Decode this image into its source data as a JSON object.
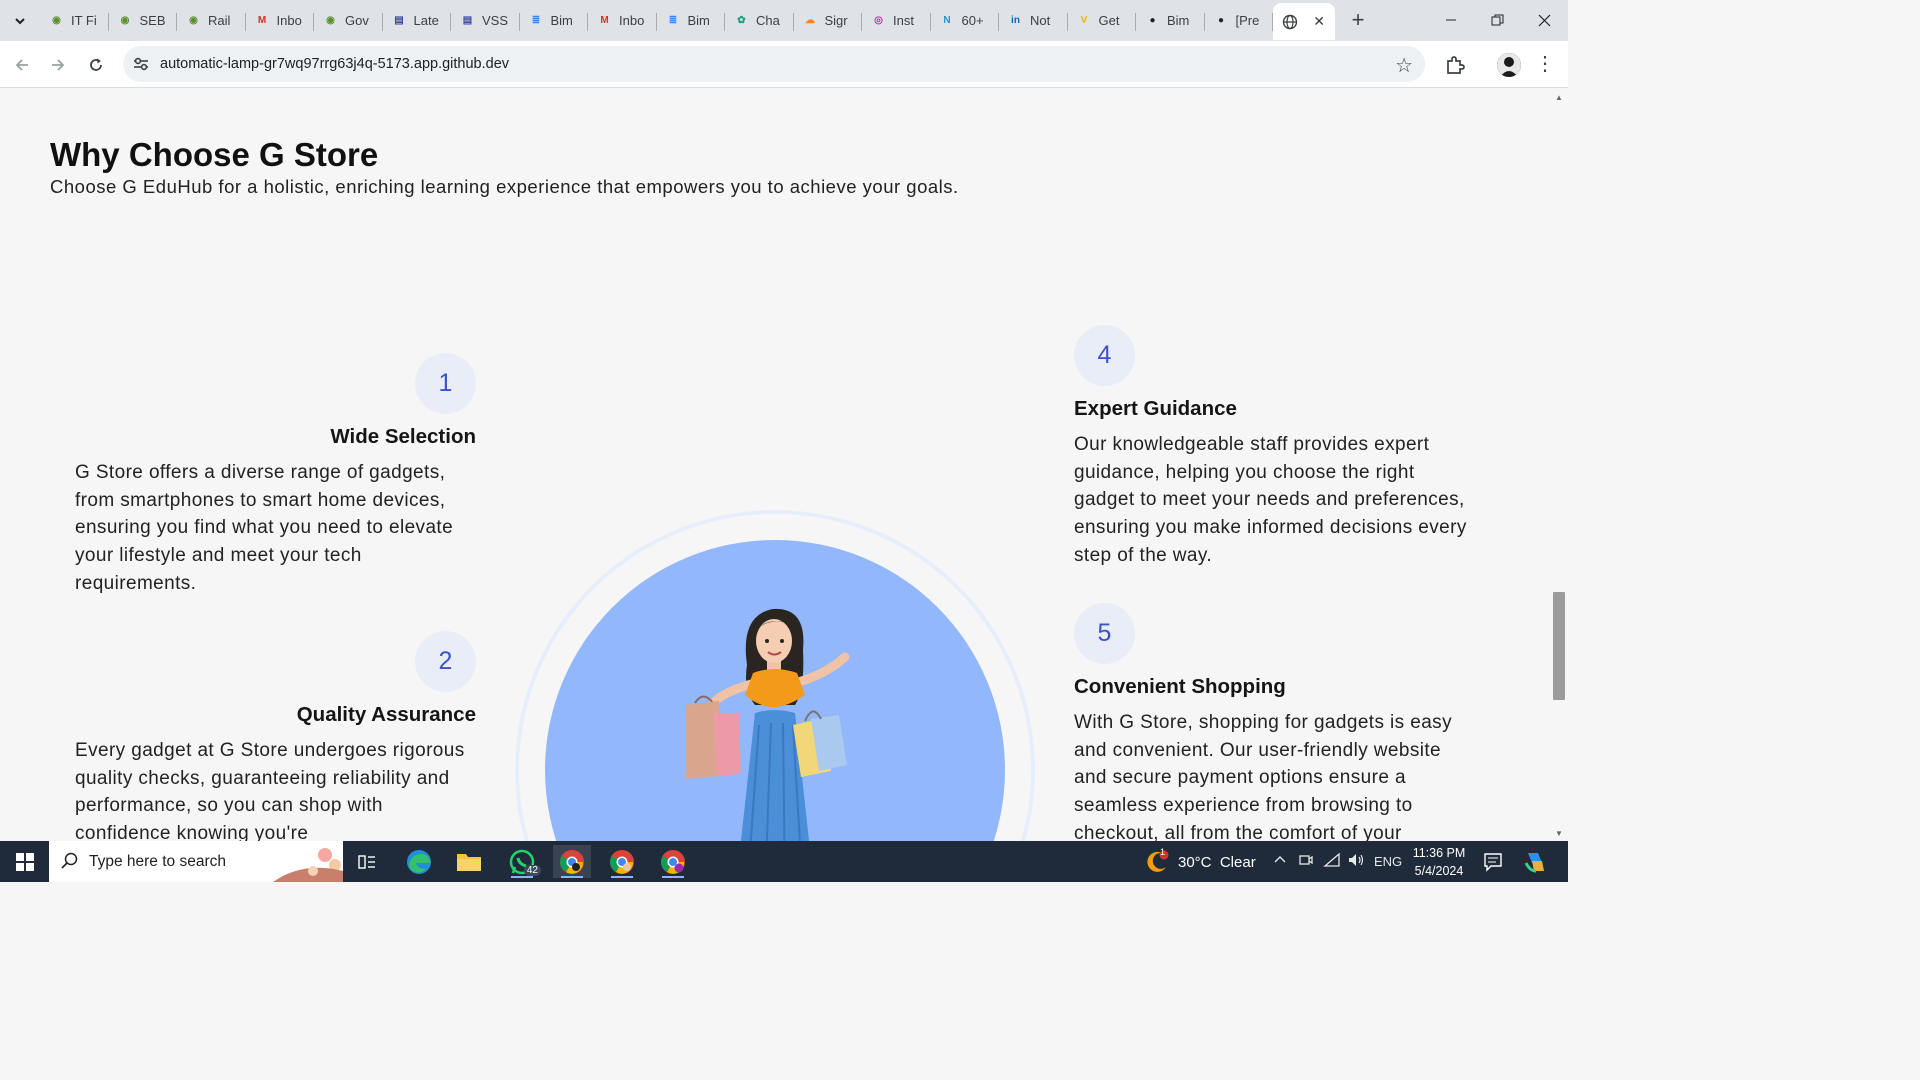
{
  "browser": {
    "tabs": [
      {
        "label": "IT Fi",
        "icon": "site-icon",
        "color": "#5a8f2c"
      },
      {
        "label": "SEB",
        "icon": "site-icon",
        "color": "#5a8f2c"
      },
      {
        "label": "Rail",
        "icon": "site-icon",
        "color": "#5a8f2c"
      },
      {
        "label": "Inbo",
        "icon": "gmail-icon",
        "color": "#d93025"
      },
      {
        "label": "Gov",
        "icon": "site-icon",
        "color": "#5a8f2c"
      },
      {
        "label": "Late",
        "icon": "exam-icon",
        "color": "#3b4a9c"
      },
      {
        "label": "VSS",
        "icon": "exam-icon",
        "color": "#3b4a9c"
      },
      {
        "label": "Bim",
        "icon": "docs-icon",
        "color": "#4285f4"
      },
      {
        "label": "Inbo",
        "icon": "gmail-icon",
        "color": "#d93025"
      },
      {
        "label": "Bim",
        "icon": "docs-icon",
        "color": "#4285f4"
      },
      {
        "label": "Cha",
        "icon": "chatgpt-icon",
        "color": "#10a37f"
      },
      {
        "label": "Sigr",
        "icon": "cloudflare-icon",
        "color": "#f6821f"
      },
      {
        "label": "Inst",
        "icon": "instagram-icon",
        "color": "#d6249f"
      },
      {
        "label": "60+",
        "icon": "n-icon",
        "color": "#2196c9"
      },
      {
        "label": "Not",
        "icon": "linkedin-icon",
        "color": "#0a66c2"
      },
      {
        "label": "Get",
        "icon": "v-icon",
        "color": "#f0b400"
      },
      {
        "label": "Bim",
        "icon": "github-icon",
        "color": "#1f2328"
      },
      {
        "label": "[Pre",
        "icon": "github-icon",
        "color": "#1f2328"
      }
    ],
    "active_tab_icon": "globe-icon",
    "url": "automatic-lamp-gr7wq97rrg63j4q-5173.app.github.dev"
  },
  "page": {
    "heading": "Why Choose G Store",
    "subheading": "Choose G EduHub for a holistic, enriching learning experience that empowers you to achieve your goals.",
    "features": [
      {
        "number": "1",
        "title": "Wide Selection",
        "description": "G Store offers a diverse range of gadgets, from smartphones to smart home devices, ensuring you find what you need to elevate your lifestyle and meet your tech requirements."
      },
      {
        "number": "2",
        "title": "Quality Assurance",
        "description": "Every gadget at G Store undergoes rigorous quality checks, guaranteeing reliability and performance, so you can shop with confidence knowing you're"
      },
      {
        "number": "4",
        "title": "Expert Guidance",
        "description": "Our knowledgeable staff provides expert guidance, helping you choose the right gadget to meet your needs and preferences, ensuring you make informed decisions every step of the way."
      },
      {
        "number": "5",
        "title": "Convenient Shopping",
        "description": "With G Store, shopping for gadgets is easy and convenient. Our user-friendly website and secure payment options ensure a seamless experience from browsing to checkout, all from the comfort of your"
      }
    ],
    "accent_color": "#3b53c4",
    "hero_color": "#92b7fb"
  },
  "taskbar": {
    "search_placeholder": "Type here to search",
    "whatsapp_badge": "42",
    "weather": "30°C  Clear",
    "weather_badge": "1",
    "language": "ENG",
    "time": "11:36 PM",
    "date": "5/4/2024"
  }
}
